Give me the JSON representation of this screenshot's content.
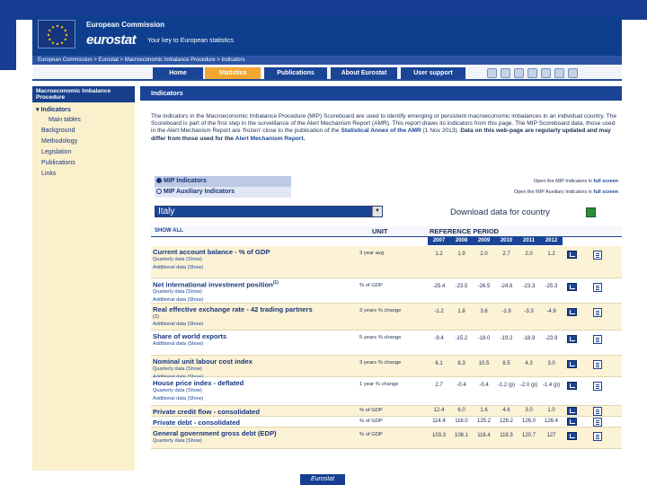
{
  "header": {
    "ec_name": "European Commission",
    "logo": "eurostat",
    "tagline": "Your key to European statistics"
  },
  "breadcrumb": "European Commission > Eurostat > Macroeconomic Imbalance Procedure > Indicators",
  "nav": {
    "tabs": [
      "Home",
      "Statistics",
      "Publications",
      "About Eurostat",
      "User support"
    ],
    "active_index": 1
  },
  "sidebar": {
    "heading": "Macroeconomic Imbalance Procedure",
    "items": [
      {
        "label": "Indicators",
        "active": true
      },
      {
        "label": "Main tables",
        "sub": true
      },
      {
        "label": "Background"
      },
      {
        "label": "Methodology"
      },
      {
        "label": "Legislation"
      },
      {
        "label": "Publications"
      },
      {
        "label": "Links"
      }
    ]
  },
  "content": {
    "title": "Indicators",
    "intro_text": "The indicators in the Macroeconomic Imbalance Procedure (MIP) Scoreboard are used to identify emerging or persistent macroeconomic imbalances in an individual country. The Scoreboard is part of the first step in the surveillance of the Alert Mechanism Report (AMR). This report draws its indicators from this page. The MIP Scoreboard data, those used in the Alert Mechanism Report are 'frozen' close to the publication of the",
    "intro_link": "Statistical Annex of the AMR",
    "intro_tail": "(1 Nov 2013).",
    "intro_bold": "Data on this web-page are regularly updated and may differ from those used for the",
    "intro_bold_link": "Alert Mechanism Report.",
    "radio_mip": "MIP Indicators",
    "radio_aux": "MIP Auxiliary Indicators",
    "open_mip_prefix": "Open the MIP Indicators in",
    "open_aux_prefix": "Open the MIP Auxiliary Indicators in",
    "full_screen": "full screen",
    "country": "Italy",
    "download_label": "Download data for country"
  },
  "table": {
    "show_all": "SHOW ALL",
    "unit_header": "UNIT",
    "ref_header": "REFERENCE PERIOD",
    "years": [
      "2007",
      "2008",
      "2009",
      "2010",
      "2011",
      "2012"
    ],
    "quarterly_label": "Quarterly data (Show)",
    "additional_label": "Additional data (Show)",
    "rows": [
      {
        "name": "Current account balance - % of GDP",
        "sub": [
          "Quarterly data (Show)",
          "Additional data (Show)"
        ],
        "unit": "3 year avg",
        "values": [
          "1.2",
          "1.9",
          "2.0",
          "2.7",
          "2.0",
          "1.2"
        ]
      },
      {
        "name": "Net international investment position",
        "sup": "(1)",
        "sub": [
          "Quarterly data (Show)",
          "Additional data (Show)"
        ],
        "unit": "% of GDP",
        "values": [
          "-25.4",
          "-23.5",
          "-26.5",
          "-24.8",
          "-23.3",
          "-25.3"
        ]
      },
      {
        "name": "Real effective exchange rate - 42 trading partners",
        "note": "(2)",
        "sub": [
          "Additional data (Show)"
        ],
        "unit": "3 years % change",
        "values": [
          "-1.2",
          "1.8",
          "3.6",
          "-1.9",
          "-3.3",
          "-4.9"
        ]
      },
      {
        "name": "Share of world exports",
        "sub": [
          "Additional data (Show)"
        ],
        "unit": "5 years % change",
        "values": [
          "-9.4",
          "-15.2",
          "-18.0",
          "-19.2",
          "-18.9",
          "-23.9"
        ]
      },
      {
        "name": "Nominal unit labour cost index",
        "sub": [
          "Quarterly data (Show)",
          "Additional data (Show)"
        ],
        "unit": "3 years % change",
        "values": [
          "6.1",
          "8.3",
          "10.5",
          "8.5",
          "4.3",
          "3.0"
        ]
      },
      {
        "name": "House price index - deflated",
        "sub": [
          "Quarterly data (Show)",
          "Additional data (Show)"
        ],
        "unit": "1 year % change",
        "values": [
          "2.7",
          "-0.4",
          "-0.4",
          "-1.2 (p)",
          "-2.0 (p)",
          "-1.4 (p)"
        ]
      },
      {
        "name": "Private credit flow - consolidated",
        "sub": [],
        "unit": "% of GDP",
        "values": [
          "12.4",
          "6.0",
          "1.6",
          "4.6",
          "3.0",
          "1.0"
        ]
      },
      {
        "name": "Private debt - consolidated",
        "sub": [],
        "unit": "% of GDP",
        "values": [
          "114.4",
          "116.0",
          "125.2",
          "126.2",
          "126.0",
          "126.4"
        ]
      },
      {
        "name": "General government gross debt (EDP)",
        "sub": [
          "Quarterly data (Show)"
        ],
        "unit": "% of GDP",
        "values": [
          "103.3",
          "106.1",
          "116.4",
          "119.3",
          "120.7",
          "127"
        ]
      }
    ]
  },
  "footer": {
    "label": "Eurostat"
  },
  "colors": {
    "navy": "#1a4496",
    "orange": "#f0a630",
    "cream": "#fcf3d6"
  }
}
